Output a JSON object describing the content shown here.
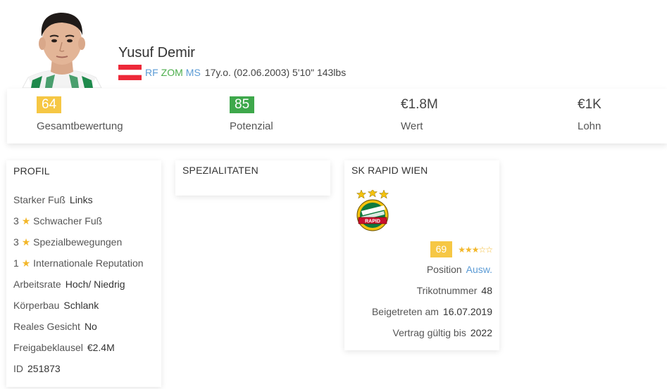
{
  "player": {
    "name": "Yusuf Demir",
    "positions": [
      "RF",
      "ZOM",
      "MS"
    ],
    "meta": "17y.o. (02.06.2003) 5'10\" 143lbs"
  },
  "stats": [
    {
      "value": "64",
      "label": "Gesamtbewertung"
    },
    {
      "value": "85",
      "label": "Potenzial"
    },
    {
      "value": "€1.8M",
      "label": "Wert"
    },
    {
      "value": "€1K",
      "label": "Lohn"
    }
  ],
  "profile": {
    "title": "PROFIL",
    "strong_foot_label": "Starker Fuß",
    "strong_foot_value": "Links",
    "weak_foot_num": "3",
    "weak_foot_label": "Schwacher Fuß",
    "skill_moves_num": "3",
    "skill_moves_label": "Spezialbewegungen",
    "reputation_num": "1",
    "reputation_label": "Internationale Reputation",
    "work_rate_label": "Arbeitsrate",
    "work_rate_value": "Hoch/ Niedrig",
    "body_label": "Körperbau",
    "body_value": "Schlank",
    "face_label": "Reales Gesicht",
    "face_value": "No",
    "release_label": "Freigabeklausel",
    "release_value": "€2.4M",
    "id_label": "ID",
    "id_value": "251873"
  },
  "specialties": {
    "title": "SPEZIALITATEN"
  },
  "club": {
    "title": "SK RAPID WIEN",
    "rating": "69",
    "stars": "★★★☆☆",
    "position_label": "Position",
    "position_value": "Ausw.",
    "jersey_label": "Trikotnummer",
    "jersey_value": "48",
    "joined_label": "Beigetreten am",
    "joined_value": "16.07.2019",
    "contract_label": "Vertrag gültig bis",
    "contract_value": "2022"
  },
  "colors": {
    "badge_yellow": "#f6c744",
    "badge_green": "#3ea84b",
    "link_blue": "#5b9bd5",
    "position_green": "#4cae4c",
    "star": "#f3b72a"
  },
  "icons": {
    "flag": "austria-flag",
    "club_logo": "rapid-wien-crest",
    "avatar": "player-photo"
  }
}
